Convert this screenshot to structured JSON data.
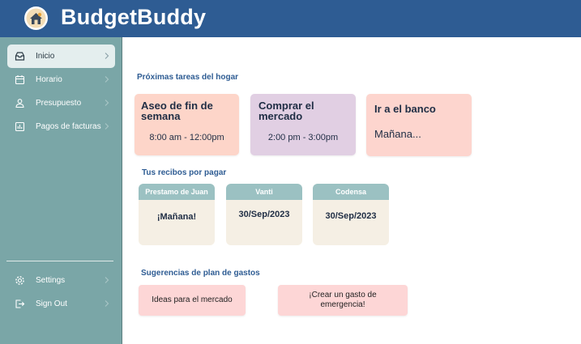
{
  "app": {
    "title": "BudgetBuddy"
  },
  "colors": {
    "header": "#2e5c93",
    "sidebar": "#7aa6a7",
    "accent": "#2e5c93"
  },
  "sidebar": {
    "items": [
      {
        "label": "Inicio",
        "icon": "inbox-icon",
        "active": true
      },
      {
        "label": "Horario",
        "icon": "calendar-icon",
        "active": false
      },
      {
        "label": "Presupuesto",
        "icon": "users-icon",
        "active": false
      },
      {
        "label": "Pagos de facturas",
        "icon": "chart-icon",
        "active": false
      }
    ],
    "bottom_items": [
      {
        "label": "Settings",
        "icon": "gear-icon"
      },
      {
        "label": "Sign Out",
        "icon": "sign-out-icon"
      }
    ]
  },
  "tasks": {
    "title": "Próximas tareas del hogar",
    "cards": [
      {
        "title": "Aseo de fin de semana",
        "time": "8:00 am - 12:00pm",
        "color": "#fdd5c9"
      },
      {
        "title": "Comprar el mercado",
        "time": "2:00 pm - 3:00pm",
        "color": "#e1cfe3"
      },
      {
        "title": "Ir a el banco",
        "time": "Mañana...",
        "color": "#fdd5ce"
      }
    ]
  },
  "bills": {
    "title": "Tus recibos por pagar",
    "cards": [
      {
        "name": "Prestamo de Juan",
        "due": "¡Mañana!"
      },
      {
        "name": "Vanti",
        "due": "30/Sep/2023"
      },
      {
        "name": "Codensa",
        "due": "30/Sep/2023"
      }
    ]
  },
  "suggestions": {
    "title": "Sugerencias de plan de gastos",
    "items": [
      {
        "label": "Ideas para el mercado"
      },
      {
        "label": "¡Crear un gasto de emergencia!"
      }
    ]
  }
}
